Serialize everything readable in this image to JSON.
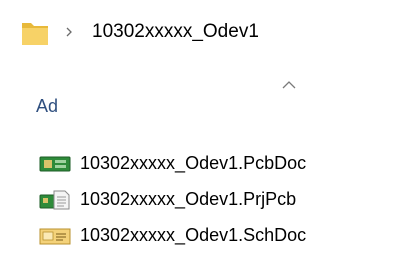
{
  "address_bar": {
    "folder_icon": "folder-icon",
    "separator_icon": "chevron-right-icon",
    "current_folder": "10302xxxxx_Odev1"
  },
  "file_list": {
    "sort_indicator_icon": "sort-ascending-icon",
    "column_header": "Ad",
    "files": [
      {
        "name": "10302xxxxx_Odev1.PcbDoc",
        "icon": "pcb-document-icon"
      },
      {
        "name": "10302xxxxx_Odev1.PrjPcb",
        "icon": "pcb-project-icon"
      },
      {
        "name": "10302xxxxx_Odev1.SchDoc",
        "icon": "schematic-document-icon"
      }
    ]
  },
  "colors": {
    "folder": "#f3c94d",
    "header_text": "#2f4f7f",
    "chevron": "#6b6b6b",
    "pcb_green": "#2e8b3a"
  }
}
